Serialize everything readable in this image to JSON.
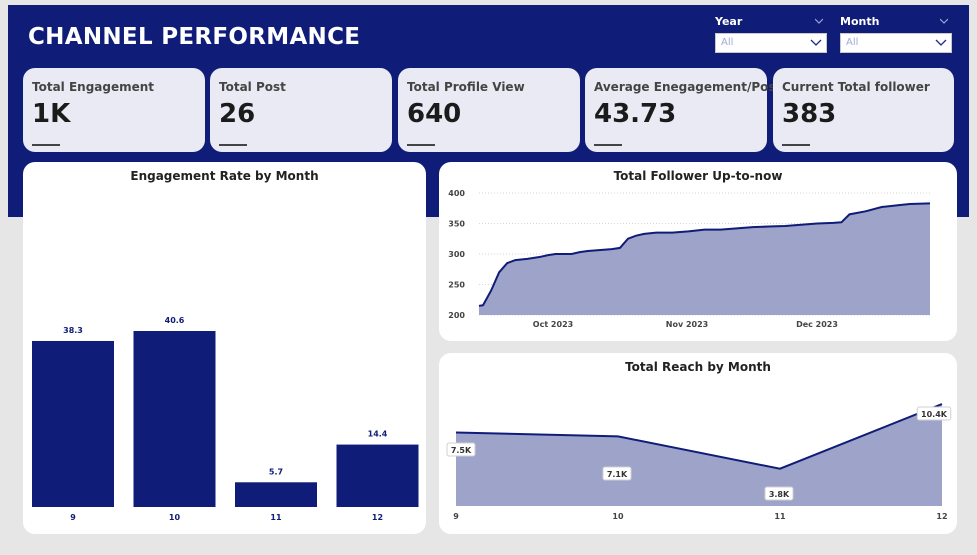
{
  "header": {
    "title": "CHANNEL PERFORMANCE"
  },
  "filters": {
    "year": {
      "label": "Year",
      "value": "All"
    },
    "month": {
      "label": "Month",
      "value": "All"
    }
  },
  "kpis": [
    {
      "label": "Total Engagement",
      "value": "1K"
    },
    {
      "label": "Total Post",
      "value": "26"
    },
    {
      "label": "Total Profile View",
      "value": "640"
    },
    {
      "label": "Average Enegagement/Post",
      "value": "43.73"
    },
    {
      "label": "Current Total follower",
      "value": "383"
    }
  ],
  "colors": {
    "navy": "#0f1c78",
    "area_fill": "#9ea4c9",
    "kpi_bg": "#e9eaf4"
  },
  "chart_data": [
    {
      "type": "bar",
      "title": "Engagement Rate by Month",
      "categories": [
        "9",
        "10",
        "11",
        "12"
      ],
      "values": [
        38.3,
        40.6,
        5.7,
        14.4
      ],
      "value_labels": [
        "38.3",
        "40.6",
        "5.7",
        "14.4"
      ],
      "ylim": [
        0,
        42
      ],
      "grid": false
    },
    {
      "type": "area",
      "title": "Total Follower Up-to-now",
      "x_ticks": [
        "Oct 2023",
        "Nov 2023",
        "Dec 2023"
      ],
      "y_ticks": [
        "400",
        "350",
        "300",
        "250",
        "200"
      ],
      "ylim": [
        200,
        400
      ],
      "x": [
        "2023-09-19",
        "2023-09-20",
        "2023-09-22",
        "2023-09-24",
        "2023-09-26",
        "2023-09-28",
        "2023-10-01",
        "2023-10-04",
        "2023-10-06",
        "2023-10-08",
        "2023-10-10",
        "2023-10-12",
        "2023-10-14",
        "2023-10-16",
        "2023-10-18",
        "2023-10-20",
        "2023-10-22",
        "2023-10-24",
        "2023-10-26",
        "2023-10-28",
        "2023-10-30",
        "2023-11-02",
        "2023-11-06",
        "2023-11-10",
        "2023-11-14",
        "2023-11-18",
        "2023-11-22",
        "2023-11-26",
        "2023-11-30",
        "2023-12-04",
        "2023-12-08",
        "2023-12-12",
        "2023-12-16",
        "2023-12-18",
        "2023-12-20",
        "2023-12-24",
        "2023-12-28",
        "2024-01-01",
        "2024-01-04",
        "2024-01-09"
      ],
      "values": [
        215,
        216,
        240,
        270,
        285,
        290,
        292,
        295,
        298,
        300,
        300,
        300,
        303,
        305,
        306,
        307,
        308,
        310,
        325,
        330,
        333,
        335,
        335,
        337,
        340,
        340,
        342,
        344,
        345,
        346,
        348,
        350,
        351,
        352,
        365,
        370,
        377,
        380,
        382,
        383
      ],
      "grid": true
    },
    {
      "type": "area",
      "title": "Total Reach by Month",
      "categories": [
        "9",
        "10",
        "11",
        "12"
      ],
      "values": [
        7.5,
        7.1,
        3.8,
        10.4
      ],
      "value_labels": [
        "7.5K",
        "7.1K",
        "3.8K",
        "10.4K"
      ],
      "ylim": [
        0,
        10.4
      ],
      "grid": false
    }
  ]
}
